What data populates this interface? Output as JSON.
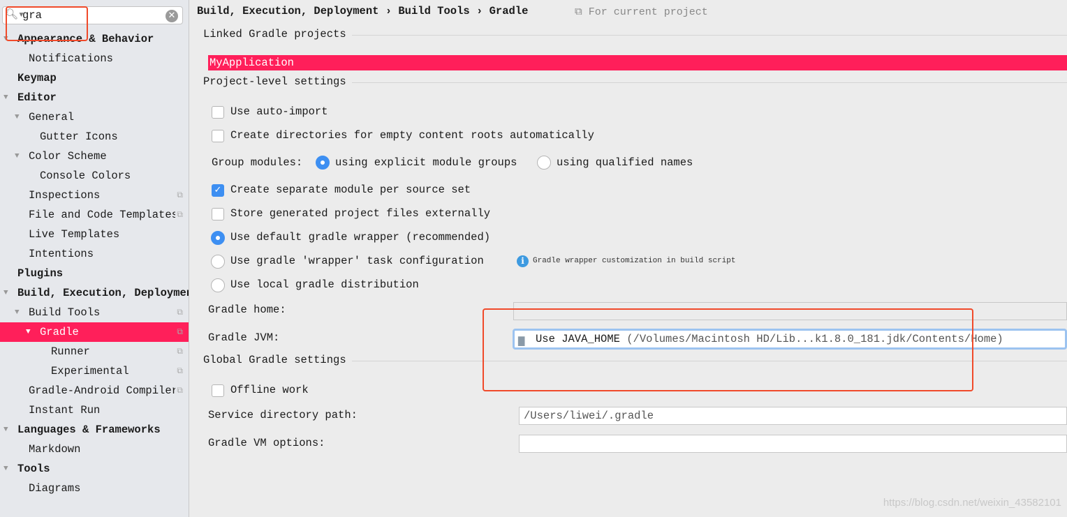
{
  "search": {
    "value": "gra"
  },
  "sidebar": {
    "items": [
      {
        "label": "Appearance & Behavior",
        "level": 0,
        "bold": true,
        "expanded": true
      },
      {
        "label": "Notifications",
        "level": 1
      },
      {
        "label": "Keymap",
        "level": 0,
        "bold": true
      },
      {
        "label": "Editor",
        "level": 0,
        "bold": true,
        "expanded": true
      },
      {
        "label": "General",
        "level": 1,
        "expanded": true
      },
      {
        "label": "Gutter Icons",
        "level": 2
      },
      {
        "label": "Color Scheme",
        "level": 1,
        "expanded": true
      },
      {
        "label": "Console Colors",
        "level": 2
      },
      {
        "label": "Inspections",
        "level": 1,
        "copy": true
      },
      {
        "label": "File and Code Templates",
        "level": 1,
        "copy": true
      },
      {
        "label": "Live Templates",
        "level": 1
      },
      {
        "label": "Intentions",
        "level": 1
      },
      {
        "label": "Plugins",
        "level": 0,
        "bold": true
      },
      {
        "label": "Build, Execution, Deployment",
        "level": 0,
        "bold": true,
        "expanded": true
      },
      {
        "label": "Build Tools",
        "level": 1,
        "expanded": true,
        "copy": true
      },
      {
        "label": "Gradle",
        "level": 2,
        "expanded": true,
        "selected": true,
        "copy": true
      },
      {
        "label": "Runner",
        "level": 3,
        "copy": true
      },
      {
        "label": "Experimental",
        "level": 3,
        "copy": true
      },
      {
        "label": "Gradle-Android Compiler",
        "level": 1,
        "copy": true
      },
      {
        "label": "Instant Run",
        "level": 1
      },
      {
        "label": "Languages & Frameworks",
        "level": 0,
        "bold": true,
        "expanded": true
      },
      {
        "label": "Markdown",
        "level": 1
      },
      {
        "label": "Tools",
        "level": 0,
        "bold": true,
        "expanded": true
      },
      {
        "label": "Diagrams",
        "level": 1
      }
    ]
  },
  "breadcrumb": {
    "parts": [
      "Build, Execution, Deployment",
      "Build Tools",
      "Gradle"
    ],
    "scope": "For current project"
  },
  "linked": {
    "title": "Linked Gradle projects",
    "project": "MyApplication"
  },
  "project_level": {
    "title": "Project-level settings",
    "auto_import": "Use auto-import",
    "create_dirs": "Create directories for empty content roots automatically",
    "group_modules": "Group modules:",
    "group_explicit": "using explicit module groups",
    "group_qualified": "using qualified names",
    "separate_module": "Create separate module per source set",
    "store_external": "Store generated project files externally",
    "default_wrapper": "Use default gradle wrapper (recommended)",
    "wrapper_task": "Use gradle 'wrapper' task configuration",
    "wrapper_hint": "Gradle wrapper customization in build script",
    "local_dist": "Use local gradle distribution",
    "gradle_home_label": "Gradle home:",
    "gradle_home_value": "",
    "jvm_label": "Gradle JVM:",
    "jvm_value": "Use JAVA_HOME",
    "jvm_path": "(/Volumes/Macintosh HD/Lib...k1.8.0_181.jdk/Contents/Home)"
  },
  "global": {
    "title": "Global Gradle settings",
    "offline": "Offline work",
    "service_label": "Service directory path:",
    "service_value": "/Users/liwei/.gradle",
    "vm_label": "Gradle VM options:",
    "vm_value": ""
  },
  "watermark": "https://blog.csdn.net/weixin_43582101",
  "colors": {
    "selection": "#ff1f5a",
    "accent": "#3d8ff2",
    "annotation": "#f04a2a"
  }
}
